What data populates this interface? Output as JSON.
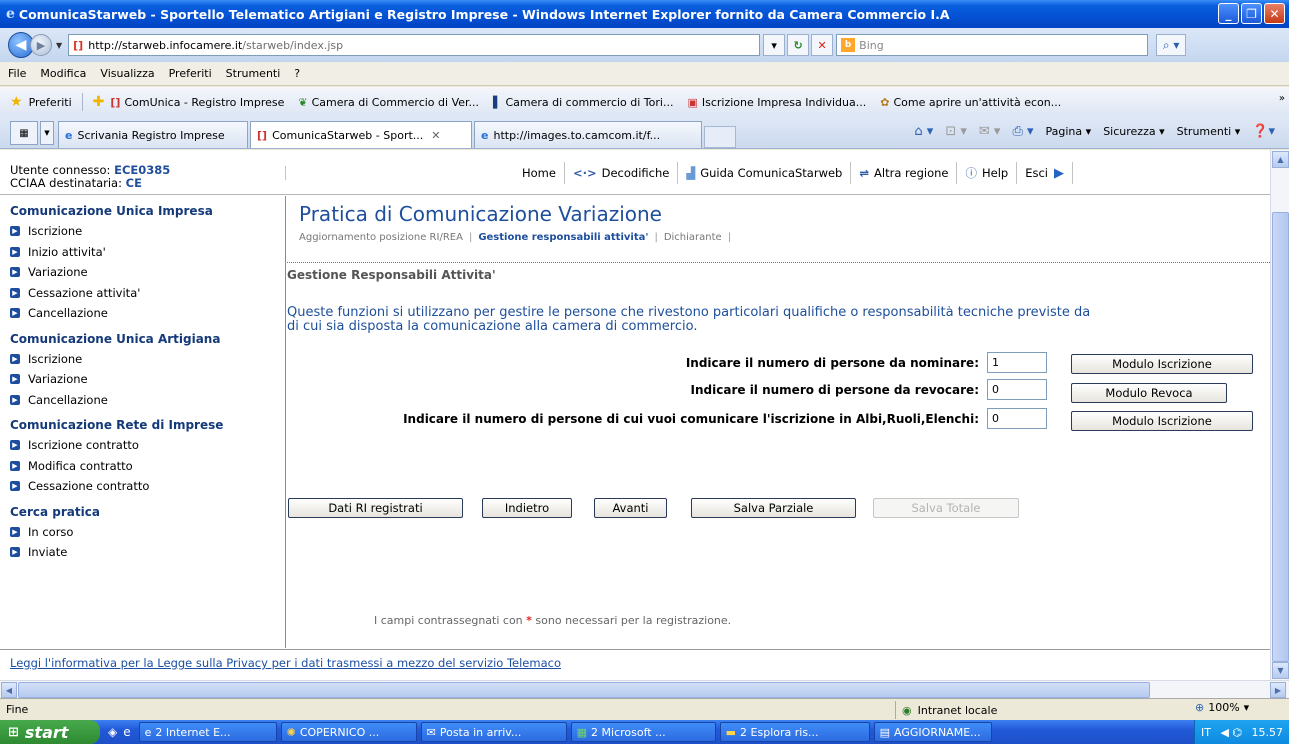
{
  "window": {
    "title": "ComunicaStarweb - Sportello Telematico Artigiani e Registro Imprese - Windows Internet Explorer fornito da Camera Commercio I.A"
  },
  "address": {
    "url_domain": "http://starweb.infocamere.it",
    "url_path": "/starweb/index.jsp",
    "search_placeholder": "Bing"
  },
  "menu": [
    "File",
    "Modifica",
    "Visualizza",
    "Preferiti",
    "Strumenti",
    "?"
  ],
  "favorites": {
    "label": "Preferiti",
    "items": [
      "ComUnica - Registro Imprese",
      "Camera di Commercio di Ver...",
      "Camera di commercio di Tori...",
      "Iscrizione Impresa Individua...",
      "Come aprire un'attività econ..."
    ]
  },
  "tabs": [
    {
      "label": "Scrivania Registro Imprese"
    },
    {
      "label": "ComunicaStarweb - Sport..."
    },
    {
      "label": "http://images.to.camcom.it/f..."
    }
  ],
  "commandbar": {
    "page": "Pagina",
    "security": "Sicurezza",
    "tools": "Strumenti"
  },
  "user": {
    "label_user": "Utente connesso:",
    "user_id": "ECE0385",
    "label_cciaa": "CCIAA destinataria:",
    "cciaa": "CE"
  },
  "topnav": {
    "home": "Home",
    "decodifiche": "Decodifiche",
    "guida": "Guida ComunicaStarweb",
    "altra_regione": "Altra regione",
    "help": "Help",
    "esci": "Esci"
  },
  "sidebar": {
    "sections": [
      {
        "title": "Comunicazione Unica Impresa",
        "items": [
          "Iscrizione",
          "Inizio attivita'",
          "Variazione",
          "Cessazione attivita'",
          "Cancellazione"
        ]
      },
      {
        "title": "Comunicazione Unica Artigiana",
        "items": [
          "Iscrizione",
          "Variazione",
          "Cancellazione"
        ]
      },
      {
        "title": "Comunicazione Rete di Imprese",
        "items": [
          "Iscrizione contratto",
          "Modifica contratto",
          "Cessazione contratto"
        ]
      },
      {
        "title": "Cerca pratica",
        "items": [
          "In corso",
          "Inviate"
        ]
      }
    ]
  },
  "main": {
    "title": "Pratica di Comunicazione Variazione",
    "crumbs": [
      "Aggiornamento posizione RI/REA",
      "Gestione responsabili attivita'",
      "Dichiarante"
    ],
    "section_title": "Gestione Responsabili Attivita'",
    "description_line1": "Queste funzioni si utilizzano per gestire le persone che rivestono particolari qualifiche o responsabilità tecniche previste da",
    "description_line2": "di cui sia disposta la comunicazione alla camera di commercio.",
    "rows": [
      {
        "label": "Indicare il numero di persone da nominare:",
        "value": "1",
        "button": "Modulo Iscrizione"
      },
      {
        "label": "Indicare il numero di persone da revocare:",
        "value": "0",
        "button": "Modulo Revoca"
      },
      {
        "label": "Indicare il numero di persone di cui vuoi comunicare l'iscrizione in Albi,Ruoli,Elenchi:",
        "value": "0",
        "button": "Modulo Iscrizione"
      }
    ],
    "actions": {
      "dati_ri": "Dati RI registrati",
      "indietro": "Indietro",
      "avanti": "Avanti",
      "salva_parziale": "Salva Parziale",
      "salva_totale": "Salva Totale"
    },
    "note_before": "I campi contrassegnati con",
    "note_star": "*",
    "note_after": "sono necessari per la registrazione."
  },
  "footer": {
    "privacy_link": "Leggi l'informativa per la Legge sulla Privacy per i dati trasmessi a mezzo del servizio Telemaco"
  },
  "status": {
    "text": "Fine",
    "zone": "Intranet locale",
    "zoom": "100%"
  },
  "taskbar": {
    "start": "start",
    "tasks": [
      "2 Internet E...",
      "COPERNICO ...",
      "Posta in arriv...",
      "2 Microsoft ...",
      "2 Esplora ris...",
      "AGGIORNAME..."
    ],
    "lang": "IT",
    "clock": "15.57"
  }
}
